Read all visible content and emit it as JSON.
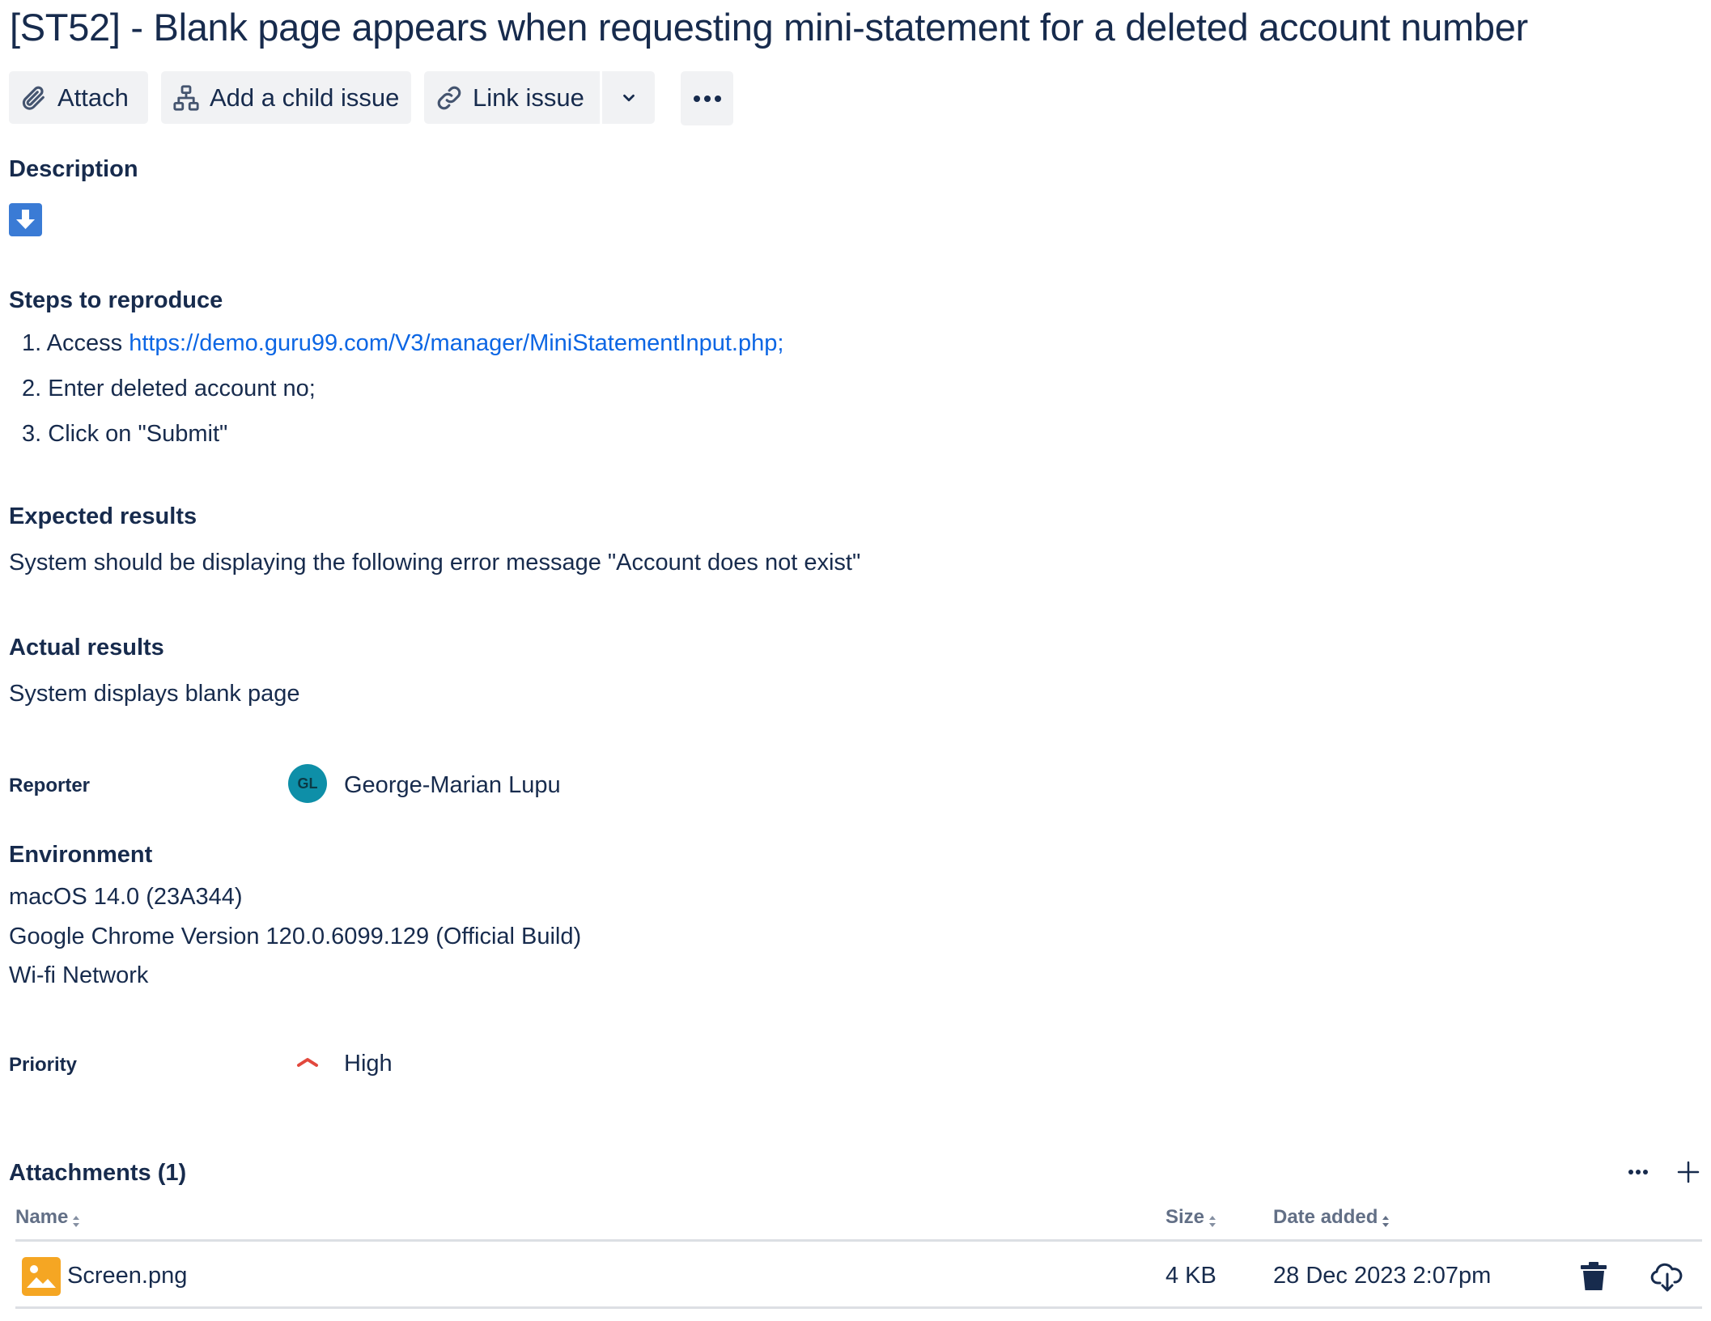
{
  "issue": {
    "title": "[ST52] - Blank page appears when requesting mini-statement for a deleted account number"
  },
  "toolbar": {
    "attach_label": "Attach",
    "add_child_label": "Add a child issue",
    "link_issue_label": "Link issue"
  },
  "description": {
    "heading": "Description",
    "steps_heading": "Steps to reproduce",
    "steps": [
      {
        "number": "1.",
        "prefix": "Access ",
        "link": "https://demo.guru99.com/V3/manager/MiniStatementInput.php;"
      },
      {
        "number": "2.",
        "text": "Enter deleted account no;"
      },
      {
        "number": "3.",
        "text": "Click on \"Submit\""
      }
    ],
    "expected_heading": "Expected results",
    "expected_text": "System should be displaying the following error message \"Account does not exist\"",
    "actual_heading": "Actual results",
    "actual_text": "System displays blank page"
  },
  "reporter": {
    "label": "Reporter",
    "initials": "GL",
    "name": "George-Marian Lupu"
  },
  "environment": {
    "heading": "Environment",
    "lines": [
      "macOS 14.0 (23A344)",
      "Google Chrome Version 120.0.6099.129 (Official Build)",
      "Wi-fi Network"
    ]
  },
  "priority": {
    "label": "Priority",
    "value": "High",
    "color": "#e2483d"
  },
  "attachments": {
    "heading": "Attachments (1)",
    "columns": [
      "Name",
      "Size",
      "Date added"
    ],
    "rows": [
      {
        "name": "Screen.png",
        "size": "4 KB",
        "date": "28 Dec 2023 2:07pm",
        "icon": "image-file-icon"
      }
    ]
  },
  "colors": {
    "text": "#172b4d",
    "link": "#0c66e4",
    "button_bg": "#f1f2f4",
    "avatar": "#0e8fa8",
    "image_icon": "#f5a623",
    "description_icon": "#3a7bd5"
  }
}
